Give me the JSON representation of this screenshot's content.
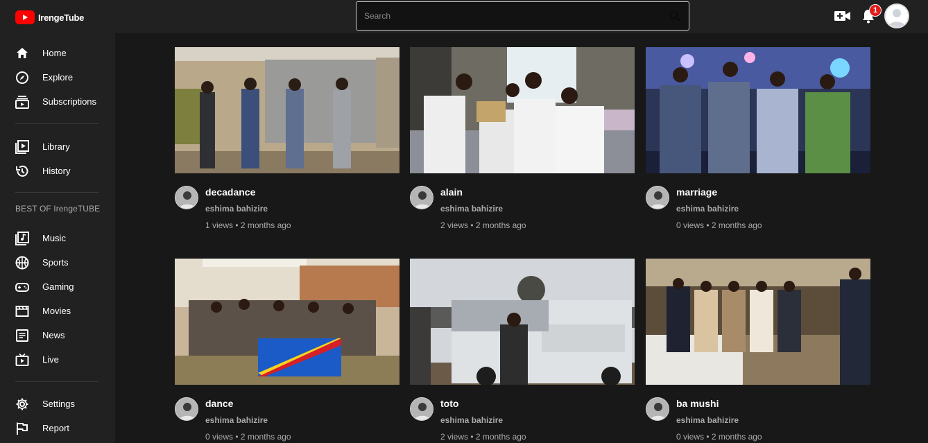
{
  "app": {
    "name": "IrengeTube"
  },
  "search": {
    "placeholder": "Search"
  },
  "header": {
    "notification_count": "1"
  },
  "sidebar": {
    "primary": [
      {
        "label": "Home",
        "icon": "home-icon"
      },
      {
        "label": "Explore",
        "icon": "compass-icon"
      },
      {
        "label": "Subscriptions",
        "icon": "subscriptions-icon"
      }
    ],
    "library": [
      {
        "label": "Library",
        "icon": "library-icon"
      },
      {
        "label": "History",
        "icon": "history-icon"
      }
    ],
    "section_title": "BEST OF IrengeTUBE",
    "best": [
      {
        "label": "Music",
        "icon": "music-icon"
      },
      {
        "label": "Sports",
        "icon": "sports-icon"
      },
      {
        "label": "Gaming",
        "icon": "gaming-icon"
      },
      {
        "label": "Movies",
        "icon": "movies-icon"
      },
      {
        "label": "News",
        "icon": "news-icon"
      },
      {
        "label": "Live",
        "icon": "live-icon"
      }
    ],
    "footer": [
      {
        "label": "Settings",
        "icon": "gear-icon"
      },
      {
        "label": "Report",
        "icon": "flag-icon"
      }
    ]
  },
  "videos": [
    {
      "title": "decadance",
      "channel": "eshima bahizire",
      "meta": "1 views • 2 months ago"
    },
    {
      "title": "alain",
      "channel": "eshima bahizire",
      "meta": "2 views • 2 months ago"
    },
    {
      "title": "marriage",
      "channel": "eshima bahizire",
      "meta": "0 views • 2 months ago"
    },
    {
      "title": "dance",
      "channel": "eshima bahizire",
      "meta": "0 views • 2 months ago"
    },
    {
      "title": "toto",
      "channel": "eshima bahizire",
      "meta": "2 views • 2 months ago"
    },
    {
      "title": "ba mushi",
      "channel": "eshima bahizire",
      "meta": "0 views • 2 months ago"
    }
  ],
  "colors": {
    "brand": "#ff0000",
    "background": "#181818",
    "surface": "#212121",
    "badge": "#e21b1b"
  }
}
